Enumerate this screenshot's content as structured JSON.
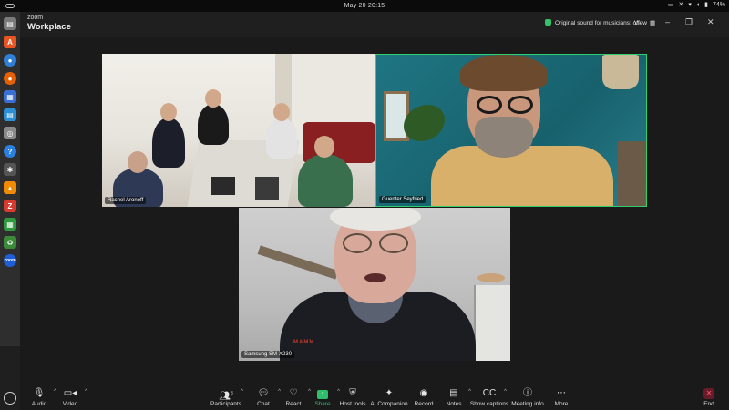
{
  "os": {
    "clock": "May 20  20:15",
    "battery": "74%"
  },
  "app": {
    "logo_small": "zoom",
    "logo_big": "Workplace",
    "sound_status": "Original sound for musicians: off",
    "view_label": "View"
  },
  "tiles": [
    {
      "name": "Rachel Aronoff"
    },
    {
      "name": "Guenter Seyfried"
    },
    {
      "name": "Samsung SM-X230"
    }
  ],
  "samsung_jacket_logo": "MAMM",
  "toolbar": {
    "audio": "Audio",
    "video": "Video",
    "participants": "Participants",
    "participants_count": "3",
    "chat": "Chat",
    "react": "React",
    "share": "Share",
    "host_tools": "Host tools",
    "ai_companion": "AI Companion",
    "record": "Record",
    "notes": "Notes",
    "show_captions": "Show captions",
    "meeting_info": "Meeting info",
    "more": "More",
    "end": "End"
  },
  "colors": {
    "active_speaker_border": "#2fd06b",
    "share_green": "#2fbf6a",
    "end_red": "#ff5c6c"
  }
}
